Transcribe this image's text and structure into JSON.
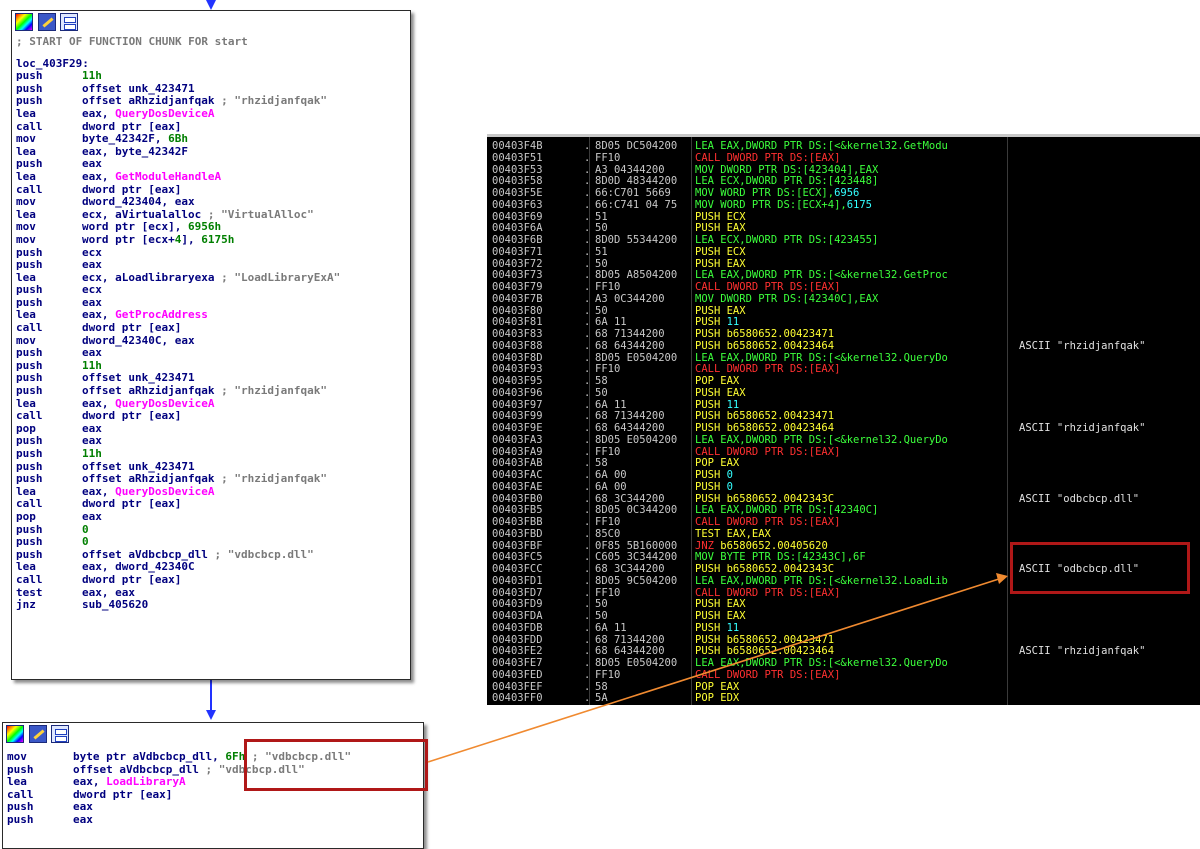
{
  "ida_top": {
    "header": "; START OF FUNCTION CHUNK FOR start",
    "label": "loc_403F29:",
    "lines": [
      {
        "m": "push",
        "o": "11h",
        "num": true
      },
      {
        "m": "push",
        "o": "offset unk_423471"
      },
      {
        "m": "push",
        "o": "offset aRhzidjanfqak",
        "c": " ; \"rhzidjanfqak\""
      },
      {
        "m": "lea",
        "o": "eax, ",
        "api": "QueryDosDeviceA"
      },
      {
        "m": "call",
        "o": "dword ptr [eax]"
      },
      {
        "m": "mov",
        "o": "byte_42342F, ",
        "n": "6Bh"
      },
      {
        "m": "lea",
        "o": "eax, byte_42342F"
      },
      {
        "m": "push",
        "o": "eax"
      },
      {
        "m": "lea",
        "o": "eax, ",
        "api": "GetModuleHandleA"
      },
      {
        "m": "call",
        "o": "dword ptr [eax]"
      },
      {
        "m": "mov",
        "o": "dword_423404, eax"
      },
      {
        "m": "lea",
        "o": "ecx, aVirtualalloc",
        "c": " ; \"VirtualAlloc\""
      },
      {
        "m": "mov",
        "o": "word ptr [ecx], ",
        "n": "6956h"
      },
      {
        "m": "mov",
        "o": "word ptr [ecx+",
        "n2": "4",
        "o2": "], ",
        "n": "6175h"
      },
      {
        "m": "push",
        "o": "ecx"
      },
      {
        "m": "push",
        "o": "eax"
      },
      {
        "m": "lea",
        "o": "ecx, aLoadlibraryexa",
        "c": " ; \"LoadLibraryExA\""
      },
      {
        "m": "push",
        "o": "ecx"
      },
      {
        "m": "push",
        "o": "eax"
      },
      {
        "m": "lea",
        "o": "eax, ",
        "api": "GetProcAddress"
      },
      {
        "m": "call",
        "o": "dword ptr [eax]"
      },
      {
        "m": "mov",
        "o": "dword_42340C, eax"
      },
      {
        "m": "push",
        "o": "eax"
      },
      {
        "m": "push",
        "o": "11h",
        "num": true
      },
      {
        "m": "push",
        "o": "offset unk_423471"
      },
      {
        "m": "push",
        "o": "offset aRhzidjanfqak",
        "c": " ; \"rhzidjanfqak\""
      },
      {
        "m": "lea",
        "o": "eax, ",
        "api": "QueryDosDeviceA"
      },
      {
        "m": "call",
        "o": "dword ptr [eax]"
      },
      {
        "m": "pop",
        "o": "eax"
      },
      {
        "m": "push",
        "o": "eax"
      },
      {
        "m": "push",
        "o": "11h",
        "num": true
      },
      {
        "m": "push",
        "o": "offset unk_423471"
      },
      {
        "m": "push",
        "o": "offset aRhzidjanfqak",
        "c": " ; \"rhzidjanfqak\""
      },
      {
        "m": "lea",
        "o": "eax, ",
        "api": "QueryDosDeviceA"
      },
      {
        "m": "call",
        "o": "dword ptr [eax]"
      },
      {
        "m": "pop",
        "o": "eax"
      },
      {
        "m": "push",
        "o": "0",
        "num": true
      },
      {
        "m": "push",
        "o": "0",
        "num": true
      },
      {
        "m": "push",
        "o": "offset aVdbcbcp_dll",
        "c": " ; \"vdbcbcp.dll\""
      },
      {
        "m": "lea",
        "o": "eax, dword_42340C"
      },
      {
        "m": "call",
        "o": "dword ptr [eax]"
      },
      {
        "m": "test",
        "o": "eax, eax"
      },
      {
        "m": "jnz",
        "o": "sub_405620"
      }
    ]
  },
  "ida_bottom": {
    "lines": [
      {
        "m": "mov",
        "o": "byte ptr aVdbcbcp_dll, ",
        "n": "6Fh",
        "c": " ; \"vdbcbcp.dll\""
      },
      {
        "m": "push",
        "o": "offset aVdbcbcp_dll",
        "c": " ; \"vdbcbcp.dll\""
      },
      {
        "m": "lea",
        "o": "eax, ",
        "api": "LoadLibraryA"
      },
      {
        "m": "call",
        "o": "dword ptr [eax]"
      },
      {
        "m": "push",
        "o": "eax"
      },
      {
        "m": "push",
        "o": "eax"
      }
    ]
  },
  "olly": {
    "rows": [
      {
        "a": "00403F4B",
        "h": "8D05 DC504200",
        "i": [
          [
            "g",
            "LEA EAX,DWORD PTR DS:[<&kernel32.GetModu"
          ]
        ],
        "c": ""
      },
      {
        "a": "00403F51",
        "h": "FF10",
        "i": [
          [
            "r",
            "CALL DWORD PTR DS:[EAX]"
          ]
        ],
        "c": ""
      },
      {
        "a": "00403F53",
        "h": "A3 04344200",
        "i": [
          [
            "g",
            "MOV DWORD PTR DS:[423404],EAX"
          ]
        ],
        "c": ""
      },
      {
        "a": "00403F58",
        "h": "8D0D 48344200",
        "i": [
          [
            "g",
            "LEA ECX,DWORD PTR DS:[423448]"
          ]
        ],
        "c": ""
      },
      {
        "a": "00403F5E",
        "h": "66:C701 5669",
        "i": [
          [
            "g",
            "MOV WORD PTR DS:[ECX],"
          ],
          [
            "c",
            "6956"
          ]
        ],
        "c": ""
      },
      {
        "a": "00403F63",
        "h": "66:C741 04 75",
        "i": [
          [
            "g",
            "MOV WORD PTR DS:[ECX+4],"
          ],
          [
            "c",
            "6175"
          ]
        ],
        "c": ""
      },
      {
        "a": "00403F69",
        "h": "51",
        "i": [
          [
            "y",
            "PUSH ECX"
          ]
        ],
        "c": ""
      },
      {
        "a": "00403F6A",
        "h": "50",
        "i": [
          [
            "y",
            "PUSH EAX"
          ]
        ],
        "c": ""
      },
      {
        "a": "00403F6B",
        "h": "8D0D 55344200",
        "i": [
          [
            "g",
            "LEA ECX,DWORD PTR DS:[423455]"
          ]
        ],
        "c": ""
      },
      {
        "a": "00403F71",
        "h": "51",
        "i": [
          [
            "y",
            "PUSH ECX"
          ]
        ],
        "c": ""
      },
      {
        "a": "00403F72",
        "h": "50",
        "i": [
          [
            "y",
            "PUSH EAX"
          ]
        ],
        "c": ""
      },
      {
        "a": "00403F73",
        "h": "8D05 A8504200",
        "i": [
          [
            "g",
            "LEA EAX,DWORD PTR DS:[<&kernel32.GetProc"
          ]
        ],
        "c": ""
      },
      {
        "a": "00403F79",
        "h": "FF10",
        "i": [
          [
            "r",
            "CALL DWORD PTR DS:[EAX]"
          ]
        ],
        "c": ""
      },
      {
        "a": "00403F7B",
        "h": "A3 0C344200",
        "i": [
          [
            "g",
            "MOV DWORD PTR DS:[42340C],EAX"
          ]
        ],
        "c": ""
      },
      {
        "a": "00403F80",
        "h": "50",
        "i": [
          [
            "y",
            "PUSH EAX"
          ]
        ],
        "c": ""
      },
      {
        "a": "00403F81",
        "h": "6A 11",
        "i": [
          [
            "y",
            "PUSH "
          ],
          [
            "c",
            "11"
          ]
        ],
        "c": ""
      },
      {
        "a": "00403F83",
        "h": "68 71344200",
        "i": [
          [
            "y",
            "PUSH b6580652.00423471"
          ]
        ],
        "c": ""
      },
      {
        "a": "00403F88",
        "h": "68 64344200",
        "i": [
          [
            "y",
            "PUSH b6580652.00423464"
          ]
        ],
        "c": "ASCII \"rhzidjanfqak\""
      },
      {
        "a": "00403F8D",
        "h": "8D05 E0504200",
        "i": [
          [
            "g",
            "LEA EAX,DWORD PTR DS:[<&kernel32.QueryDo"
          ]
        ],
        "c": ""
      },
      {
        "a": "00403F93",
        "h": "FF10",
        "i": [
          [
            "r",
            "CALL DWORD PTR DS:[EAX]"
          ]
        ],
        "c": ""
      },
      {
        "a": "00403F95",
        "h": "58",
        "i": [
          [
            "y",
            "POP EAX"
          ]
        ],
        "c": ""
      },
      {
        "a": "00403F96",
        "h": "50",
        "i": [
          [
            "y",
            "PUSH EAX"
          ]
        ],
        "c": ""
      },
      {
        "a": "00403F97",
        "h": "6A 11",
        "i": [
          [
            "y",
            "PUSH "
          ],
          [
            "c",
            "11"
          ]
        ],
        "c": ""
      },
      {
        "a": "00403F99",
        "h": "68 71344200",
        "i": [
          [
            "y",
            "PUSH b6580652.00423471"
          ]
        ],
        "c": ""
      },
      {
        "a": "00403F9E",
        "h": "68 64344200",
        "i": [
          [
            "y",
            "PUSH b6580652.00423464"
          ]
        ],
        "c": "ASCII \"rhzidjanfqak\""
      },
      {
        "a": "00403FA3",
        "h": "8D05 E0504200",
        "i": [
          [
            "g",
            "LEA EAX,DWORD PTR DS:[<&kernel32.QueryDo"
          ]
        ],
        "c": ""
      },
      {
        "a": "00403FA9",
        "h": "FF10",
        "i": [
          [
            "r",
            "CALL DWORD PTR DS:[EAX]"
          ]
        ],
        "c": ""
      },
      {
        "a": "00403FAB",
        "h": "58",
        "i": [
          [
            "y",
            "POP EAX"
          ]
        ],
        "c": ""
      },
      {
        "a": "00403FAC",
        "h": "6A 00",
        "i": [
          [
            "y",
            "PUSH "
          ],
          [
            "c",
            "0"
          ]
        ],
        "c": ""
      },
      {
        "a": "00403FAE",
        "h": "6A 00",
        "i": [
          [
            "y",
            "PUSH "
          ],
          [
            "c",
            "0"
          ]
        ],
        "c": ""
      },
      {
        "a": "00403FB0",
        "h": "68 3C344200",
        "i": [
          [
            "y",
            "PUSH b6580652.0042343C"
          ]
        ],
        "c": "ASCII \"odbcbcp.dll\""
      },
      {
        "a": "00403FB5",
        "h": "8D05 0C344200",
        "i": [
          [
            "g",
            "LEA EAX,DWORD PTR DS:[42340C]"
          ]
        ],
        "c": ""
      },
      {
        "a": "00403FBB",
        "h": "FF10",
        "i": [
          [
            "r",
            "CALL DWORD PTR DS:[EAX]"
          ]
        ],
        "c": ""
      },
      {
        "a": "00403FBD",
        "h": "85C0",
        "i": [
          [
            "y",
            "TEST EAX,EAX"
          ]
        ],
        "c": ""
      },
      {
        "a": "00403FBF",
        "h": "0F85 5B160000",
        "i": [
          [
            "r",
            "JNZ "
          ],
          [
            "y",
            "b6580652.00405620"
          ]
        ],
        "c": ""
      },
      {
        "a": "00403FC5",
        "h": "C605 3C344200",
        "i": [
          [
            "g",
            "MOV BYTE PTR DS:[42343C],6F"
          ]
        ],
        "c": ""
      },
      {
        "a": "00403FCC",
        "h": "68 3C344200",
        "i": [
          [
            "y",
            "PUSH b6580652.0042343C"
          ]
        ],
        "c": "ASCII \"odbcbcp.dll\""
      },
      {
        "a": "00403FD1",
        "h": "8D05 9C504200",
        "i": [
          [
            "g",
            "LEA EAX,DWORD PTR DS:[<&kernel32.LoadLib"
          ]
        ],
        "c": ""
      },
      {
        "a": "00403FD7",
        "h": "FF10",
        "i": [
          [
            "r",
            "CALL DWORD PTR DS:[EAX]"
          ]
        ],
        "c": ""
      },
      {
        "a": "00403FD9",
        "h": "50",
        "i": [
          [
            "y",
            "PUSH EAX"
          ]
        ],
        "c": ""
      },
      {
        "a": "00403FDA",
        "h": "50",
        "i": [
          [
            "y",
            "PUSH EAX"
          ]
        ],
        "c": ""
      },
      {
        "a": "00403FDB",
        "h": "6A 11",
        "i": [
          [
            "y",
            "PUSH "
          ],
          [
            "c",
            "11"
          ]
        ],
        "c": ""
      },
      {
        "a": "00403FDD",
        "h": "68 71344200",
        "i": [
          [
            "y",
            "PUSH b6580652.00423471"
          ]
        ],
        "c": ""
      },
      {
        "a": "00403FE2",
        "h": "68 64344200",
        "i": [
          [
            "y",
            "PUSH b6580652.00423464"
          ]
        ],
        "c": "ASCII \"rhzidjanfqak\""
      },
      {
        "a": "00403FE7",
        "h": "8D05 E0504200",
        "i": [
          [
            "g",
            "LEA EAX,DWORD PTR DS:[<&kernel32.QueryDo"
          ]
        ],
        "c": ""
      },
      {
        "a": "00403FED",
        "h": "FF10",
        "i": [
          [
            "r",
            "CALL DWORD PTR DS:[EAX]"
          ]
        ],
        "c": ""
      },
      {
        "a": "00403FEF",
        "h": "58",
        "i": [
          [
            "y",
            "POP EAX"
          ]
        ],
        "c": ""
      },
      {
        "a": "00403FF0",
        "h": "5A",
        "i": [
          [
            "y",
            "POP EDX"
          ]
        ],
        "c": ""
      }
    ]
  },
  "colors": {
    "ida_text": "#00007f",
    "ida_api": "#ff00ff",
    "ida_number": "#007f00",
    "ida_comment": "#7a7a7a",
    "olly_bg": "#000000",
    "olly_green": "#3cff3c",
    "olly_red": "#ff3030",
    "olly_yellow": "#ffff33",
    "olly_cyan": "#33ffff",
    "highlight": "#b01818",
    "connector": "#f08a30",
    "flow_arrow": "#2233ff"
  }
}
